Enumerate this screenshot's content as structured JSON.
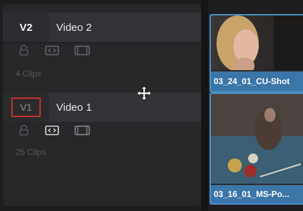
{
  "tracks": [
    {
      "id": "V2",
      "name": "Video 2",
      "clips": "4 Clips"
    },
    {
      "id": "V1",
      "name": "Video 1",
      "clips": "25 Clips"
    }
  ],
  "icons": {
    "lock": "lock-icon",
    "auto_select": "auto-select-icon",
    "disable": "track-display-icon",
    "move": "move-cursor-icon"
  },
  "clips": [
    {
      "name": "03_24_01_CU-Shot"
    },
    {
      "name": "03_16_01_MS-Po..."
    }
  ],
  "colors": {
    "selected_track": "#c3322e",
    "clip_accent": "#3a76a8"
  }
}
